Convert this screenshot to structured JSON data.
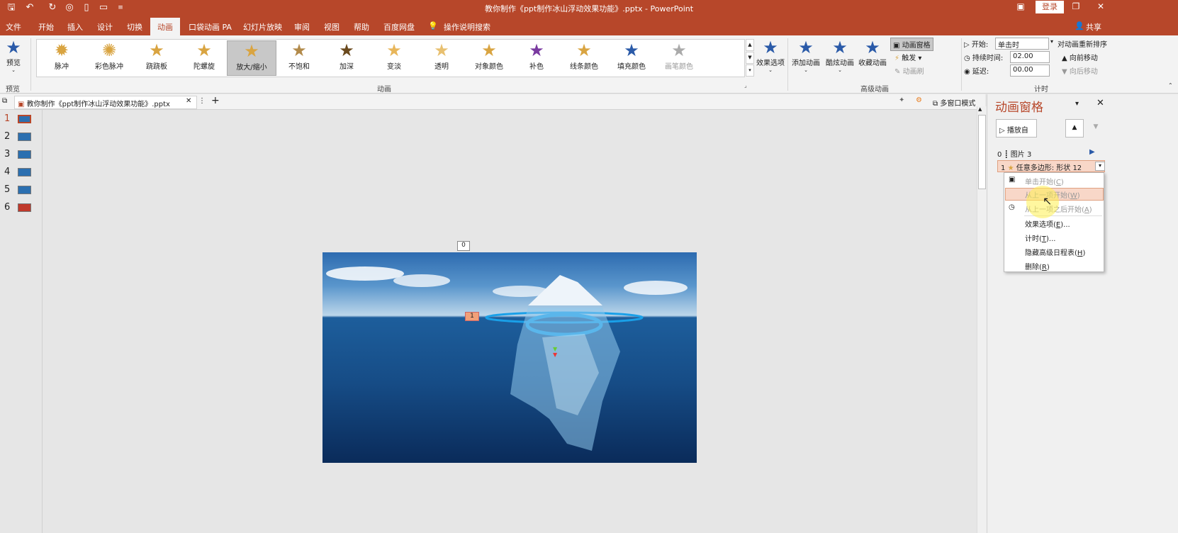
{
  "titlebar": {
    "doc_title": "教你制作《ppt制作冰山浮动效果功能》.pptx  -  PowerPoint",
    "login": "登录",
    "minimize": "—",
    "restore": "❐",
    "close": "✕",
    "share": "共享"
  },
  "tabs": [
    "文件",
    "开始",
    "插入",
    "设计",
    "切换",
    "动画",
    "口袋动画 PA",
    "幻灯片放映",
    "审阅",
    "视图",
    "帮助",
    "百度网盘"
  ],
  "search_hint": "操作说明搜索",
  "ribbon": {
    "preview": {
      "label": "预览",
      "group": "预览"
    },
    "gallery": [
      "脉冲",
      "彩色脉冲",
      "跷跷板",
      "陀螺旋",
      "放大/缩小",
      "不饱和",
      "加深",
      "变淡",
      "透明",
      "对象颜色",
      "补色",
      "线条颜色",
      "填充颜色",
      "画笔颜色"
    ],
    "gallery_selected": "放大/缩小",
    "group_animation": "动画",
    "effect_options": "效果选项",
    "add_animation": "添加动画",
    "cool_animation": "酷炫动画",
    "collect_animation": "收藏动画",
    "anim_pane_btn": "动画窗格",
    "trigger": "触发",
    "anim_brush": "动画刷",
    "group_advanced": "高级动画",
    "start_label": "开始:",
    "start_value": "单击时",
    "duration_label": "持续时间:",
    "duration_value": "02.00",
    "delay_label": "延迟:",
    "delay_value": "00.00",
    "reorder": "对动画重新排序",
    "move_earlier": "向前移动",
    "move_later": "向后移动",
    "group_timing": "计时"
  },
  "doctab": {
    "name": "教你制作《ppt制作冰山浮动效果功能》.pptx",
    "multiwindow": "多窗口模式"
  },
  "thumbnails": [
    "1",
    "2",
    "3",
    "4",
    "5",
    "6"
  ],
  "slide": {
    "tag0": "0",
    "tag1": "1"
  },
  "anim_pane": {
    "title": "动画窗格",
    "play_from": "播放自",
    "items": [
      {
        "num": "0",
        "name": "图片 3"
      },
      {
        "num": "1",
        "name": "任意多边形: 形状 12"
      }
    ]
  },
  "context_menu": {
    "items": [
      {
        "text": "单击开始(",
        "key": "C",
        "tail": ")"
      },
      {
        "text": "从上一项开始(",
        "key": "W",
        "tail": ")"
      },
      {
        "text": "从上一项之后开始(",
        "key": "A",
        "tail": ")"
      },
      {
        "text": "效果选项(",
        "key": "E",
        "tail": ")..."
      },
      {
        "text": "计时(",
        "key": "T",
        "tail": ")..."
      },
      {
        "text": "隐藏高级日程表(",
        "key": "H",
        "tail": ")"
      },
      {
        "text": "删除(",
        "key": "R",
        "tail": ")"
      }
    ]
  },
  "colors": {
    "accent": "#b7472a",
    "star_gold": "#d9a441",
    "star_blue": "#2a5aa8"
  }
}
